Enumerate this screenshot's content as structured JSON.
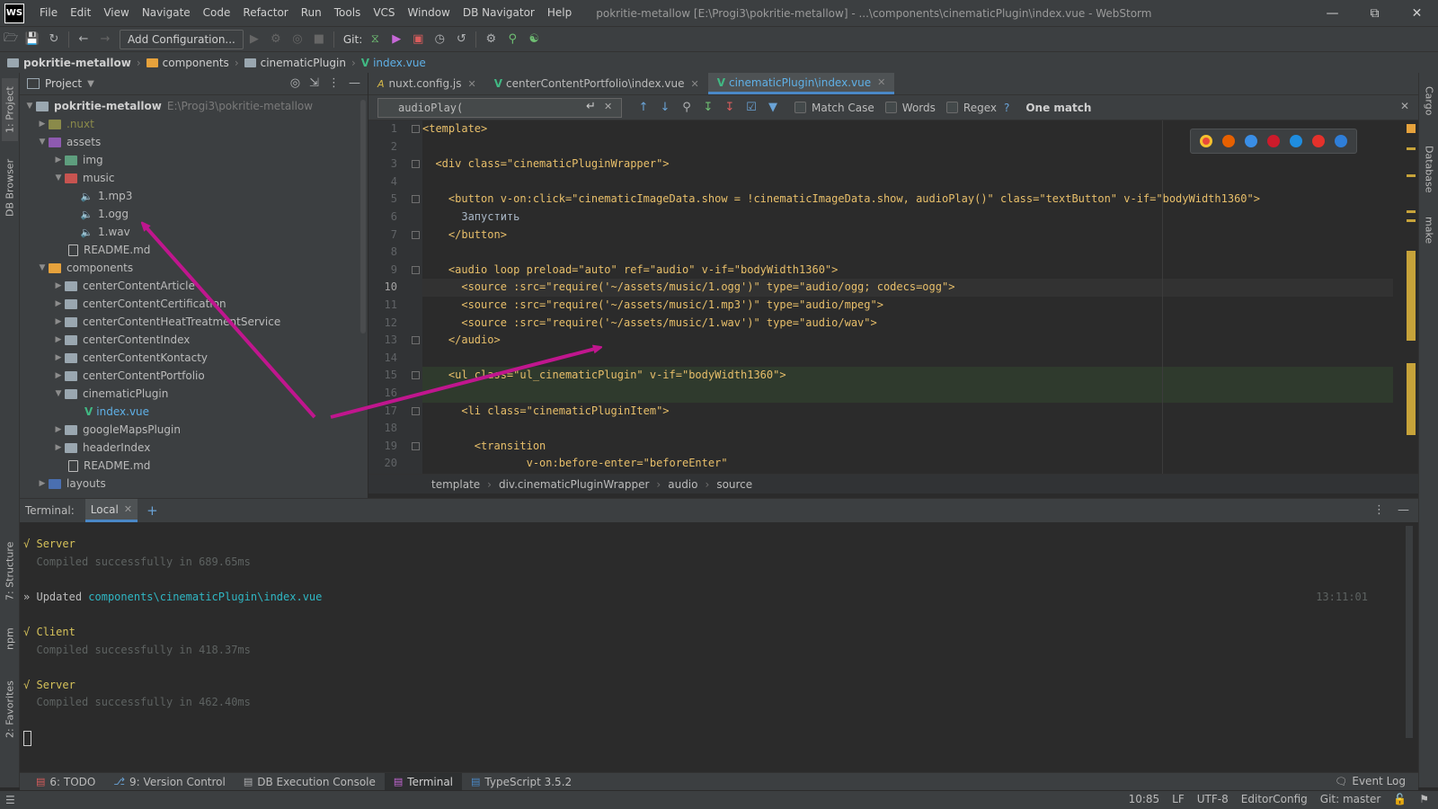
{
  "app": {
    "logo": "WS",
    "window_title": "pokritie-metallow [E:\\Progi3\\pokritie-metallow] - ...\\components\\cinematicPlugin\\index.vue - WebStorm"
  },
  "menu": [
    "File",
    "Edit",
    "View",
    "Navigate",
    "Code",
    "Refactor",
    "Run",
    "Tools",
    "VCS",
    "Window",
    "DB Navigator",
    "Help"
  ],
  "toolbar": {
    "add_config": "Add Configuration...",
    "git_label": "Git:"
  },
  "breadcrumb": [
    "pokritie-metallow",
    "components",
    "cinematicPlugin",
    "index.vue"
  ],
  "left_strip": {
    "project": "1: Project",
    "db_browser": "DB Browser",
    "structure": "7: Structure",
    "npm": "npm",
    "favorites": "2: Favorites"
  },
  "right_strip": {
    "cargo": "Cargo",
    "database": "Database",
    "make": "make"
  },
  "project_panel": {
    "title": "Project",
    "root_name": "pokritie-metallow",
    "root_path": "E:\\Progi3\\pokritie-metallow",
    "items": [
      {
        "label": ".nuxt"
      },
      {
        "label": "assets"
      },
      {
        "label": "img"
      },
      {
        "label": "music"
      },
      {
        "label": "1.mp3"
      },
      {
        "label": "1.ogg"
      },
      {
        "label": "1.wav"
      },
      {
        "label": "README.md"
      },
      {
        "label": "components"
      },
      {
        "label": "centerContentArticle"
      },
      {
        "label": "centerContentCertification"
      },
      {
        "label": "centerContentHeatTreatmentService"
      },
      {
        "label": "centerContentIndex"
      },
      {
        "label": "centerContentKontacty"
      },
      {
        "label": "centerContentPortfolio"
      },
      {
        "label": "cinematicPlugin"
      },
      {
        "label": "index.vue"
      },
      {
        "label": "googleMapsPlugin"
      },
      {
        "label": "headerIndex"
      },
      {
        "label": "README.md"
      },
      {
        "label": "layouts"
      }
    ]
  },
  "editor": {
    "tabs": [
      {
        "label": "nuxt.config.js",
        "icon": "js-icon"
      },
      {
        "label": "centerContentPortfolio\\index.vue",
        "icon": "vue-icon"
      },
      {
        "label": "cinematicPlugin\\index.vue",
        "icon": "vue-icon",
        "active": true
      }
    ],
    "find": {
      "query": "audioPlay(",
      "match_case": "Match Case",
      "words": "Words",
      "regex": "Regex",
      "help": "?",
      "result": "One match"
    },
    "line_numbers": [
      "1",
      "2",
      "3",
      "4",
      "5",
      "6",
      "7",
      "8",
      "9",
      "10",
      "11",
      "12",
      "13",
      "14",
      "15",
      "16",
      "17",
      "18",
      "19",
      "20"
    ],
    "current_line": "10",
    "lines": [
      "<template>",
      "",
      "  <div class=\"cinematicPluginWrapper\">",
      "",
      "    <button v-on:click=\"cinematicImageData.show = !cinematicImageData.show, audioPlay()\" class=\"textButton\" v-if=\"bodyWidth1360\">",
      "      Запустить",
      "    </button>",
      "",
      "    <audio loop preload=\"auto\" ref=\"audio\" v-if=\"bodyWidth1360\">",
      "      <source :src=\"require('~/assets/music/1.ogg')\" type=\"audio/ogg; codecs=ogg\">",
      "      <source :src=\"require('~/assets/music/1.mp3')\" type=\"audio/mpeg\">",
      "      <source :src=\"require('~/assets/music/1.wav')\" type=\"audio/wav\">",
      "    </audio>",
      "",
      "    <ul class=\"ul_cinematicPlugin\" v-if=\"bodyWidth1360\">",
      "",
      "      <li class=\"cinematicPluginItem\">",
      "",
      "        <transition",
      "                v-on:before-enter=\"beforeEnter\""
    ],
    "breadcrumb": [
      "template",
      "div.cinematicPluginWrapper",
      "audio",
      "source"
    ]
  },
  "terminal": {
    "title": "Terminal:",
    "tab": "Local",
    "lines": [
      {
        "mark": "√",
        "text": "Server"
      },
      {
        "text": "Compiled successfully in 689.65ms"
      },
      {
        "mark": "»",
        "label": "Updated",
        "path": "components\\cinematicPlugin\\index.vue",
        "time": "13:11:01"
      },
      {
        "mark": "√",
        "text": "Client"
      },
      {
        "text": "Compiled successfully in 418.37ms"
      },
      {
        "mark": "√",
        "text": "Server"
      },
      {
        "text": "Compiled successfully in 462.40ms"
      }
    ]
  },
  "bottom_tools": [
    {
      "label": "6: TODO",
      "icon": "todo-icon"
    },
    {
      "label": "9: Version Control",
      "icon": "vcs-icon"
    },
    {
      "label": "DB Execution Console",
      "icon": "db-console-icon"
    },
    {
      "label": "Terminal",
      "icon": "terminal-icon",
      "active": true
    },
    {
      "label": "TypeScript 3.5.2",
      "icon": "typescript-icon"
    }
  ],
  "event_log": "Event Log",
  "status": {
    "position": "10:85",
    "line_sep": "LF",
    "encoding": "UTF-8",
    "editorconfig": "EditorConfig",
    "git": "Git: master"
  },
  "colors": {
    "annotation_arrow": "#c0168e",
    "accent": "#4a88c7",
    "vue": "#41b883"
  }
}
